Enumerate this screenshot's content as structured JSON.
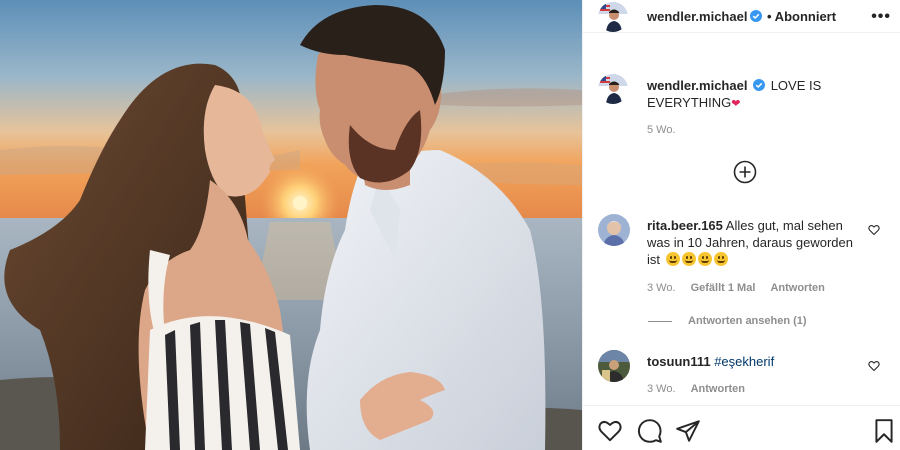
{
  "post": {
    "author": "wendler.michael",
    "header_status": "• Abonniert",
    "more_glyph": "•••",
    "caption": "LOVE IS EVERYTHING",
    "caption_emoji": "❤",
    "caption_time": "5 Wo."
  },
  "comments": [
    {
      "user": "rita.beer.165",
      "text": "Alles gut, mal sehen was in 10 Jahren, daraus geworden ist",
      "emojis": [
        "smirk",
        "blush",
        "grin",
        "grin"
      ],
      "time": "3 Wo.",
      "likes": "Gefällt 1 Mal",
      "reply": "Antworten",
      "view_replies": "Antworten ansehen (1)"
    },
    {
      "user": "tosuun111",
      "text": "#eşekherif",
      "time": "3 Wo.",
      "reply": "Antworten"
    }
  ],
  "icons": {
    "verified": "verified-badge-icon",
    "load_more": "plus-circle-icon",
    "like": "heart-icon",
    "comment": "comment-icon",
    "share": "paper-plane-icon",
    "save": "bookmark-icon"
  },
  "colors": {
    "verified": "#3897f0",
    "text": "#262626",
    "muted": "#8e8e8e",
    "hashtag": "#00376b"
  }
}
